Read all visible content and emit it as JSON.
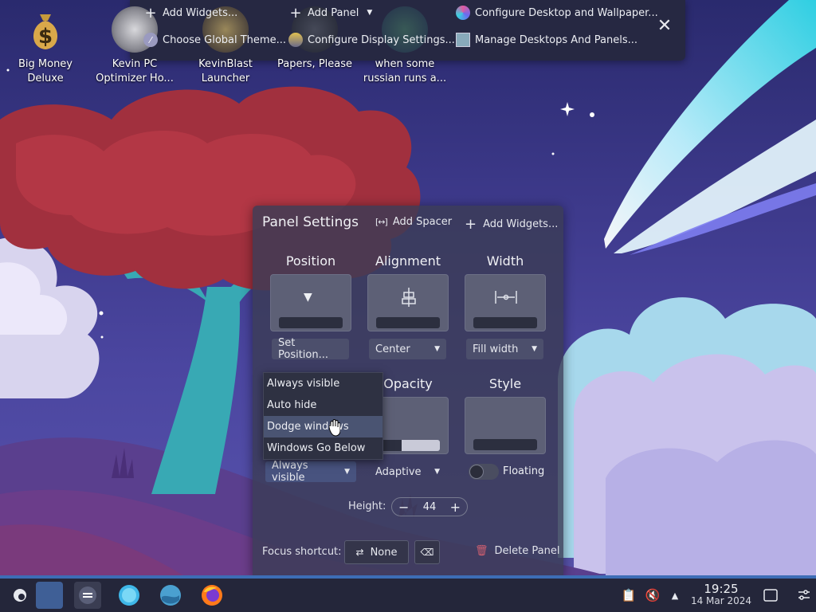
{
  "desktop_icons": [
    {
      "label": "Big Money Deluxe",
      "icon": "money-bag-icon"
    },
    {
      "label": "Kevin PC Optimizer Ho...",
      "icon": "gauge-icon"
    },
    {
      "label": "KevinBlast Launcher",
      "icon": "launcher-icon"
    },
    {
      "label": "Papers, Please",
      "icon": "papers-please-icon"
    },
    {
      "label": "when some russian runs a...",
      "icon": "video-icon"
    }
  ],
  "toolbar": {
    "add_widgets": "Add Widgets...",
    "add_panel": "Add Panel",
    "configure_desktop": "Configure Desktop and Wallpaper...",
    "choose_theme": "Choose Global Theme...",
    "configure_display": "Configure Display Settings...",
    "manage_desktops": "Manage Desktops And Panels..."
  },
  "panel_settings": {
    "title": "Panel Settings",
    "add_spacer": "Add Spacer",
    "add_widgets": "Add Widgets...",
    "position": {
      "heading": "Position",
      "button": "Set Position..."
    },
    "alignment": {
      "heading": "Alignment",
      "value": "Center"
    },
    "width": {
      "heading": "Width",
      "value": "Fill width"
    },
    "visibility": {
      "value": "Always visible",
      "options": [
        "Always visible",
        "Auto hide",
        "Dodge windows",
        "Windows Go Below"
      ],
      "highlighted": "Dodge windows"
    },
    "opacity": {
      "heading": "Opacity",
      "value": "Adaptive"
    },
    "style": {
      "heading": "Style",
      "floating_label": "Floating",
      "floating": false
    },
    "height": {
      "label": "Height:",
      "value": "44"
    },
    "focus_shortcut": {
      "label": "Focus shortcut:",
      "value": "None"
    },
    "delete_panel": "Delete Panel"
  },
  "taskbar": {
    "time": "19:25",
    "date": "14 Mar 2024"
  },
  "colors": {
    "accent": "#3d6db5",
    "panel_bg": "#24263a",
    "menu_highlight": "#4a5472"
  }
}
